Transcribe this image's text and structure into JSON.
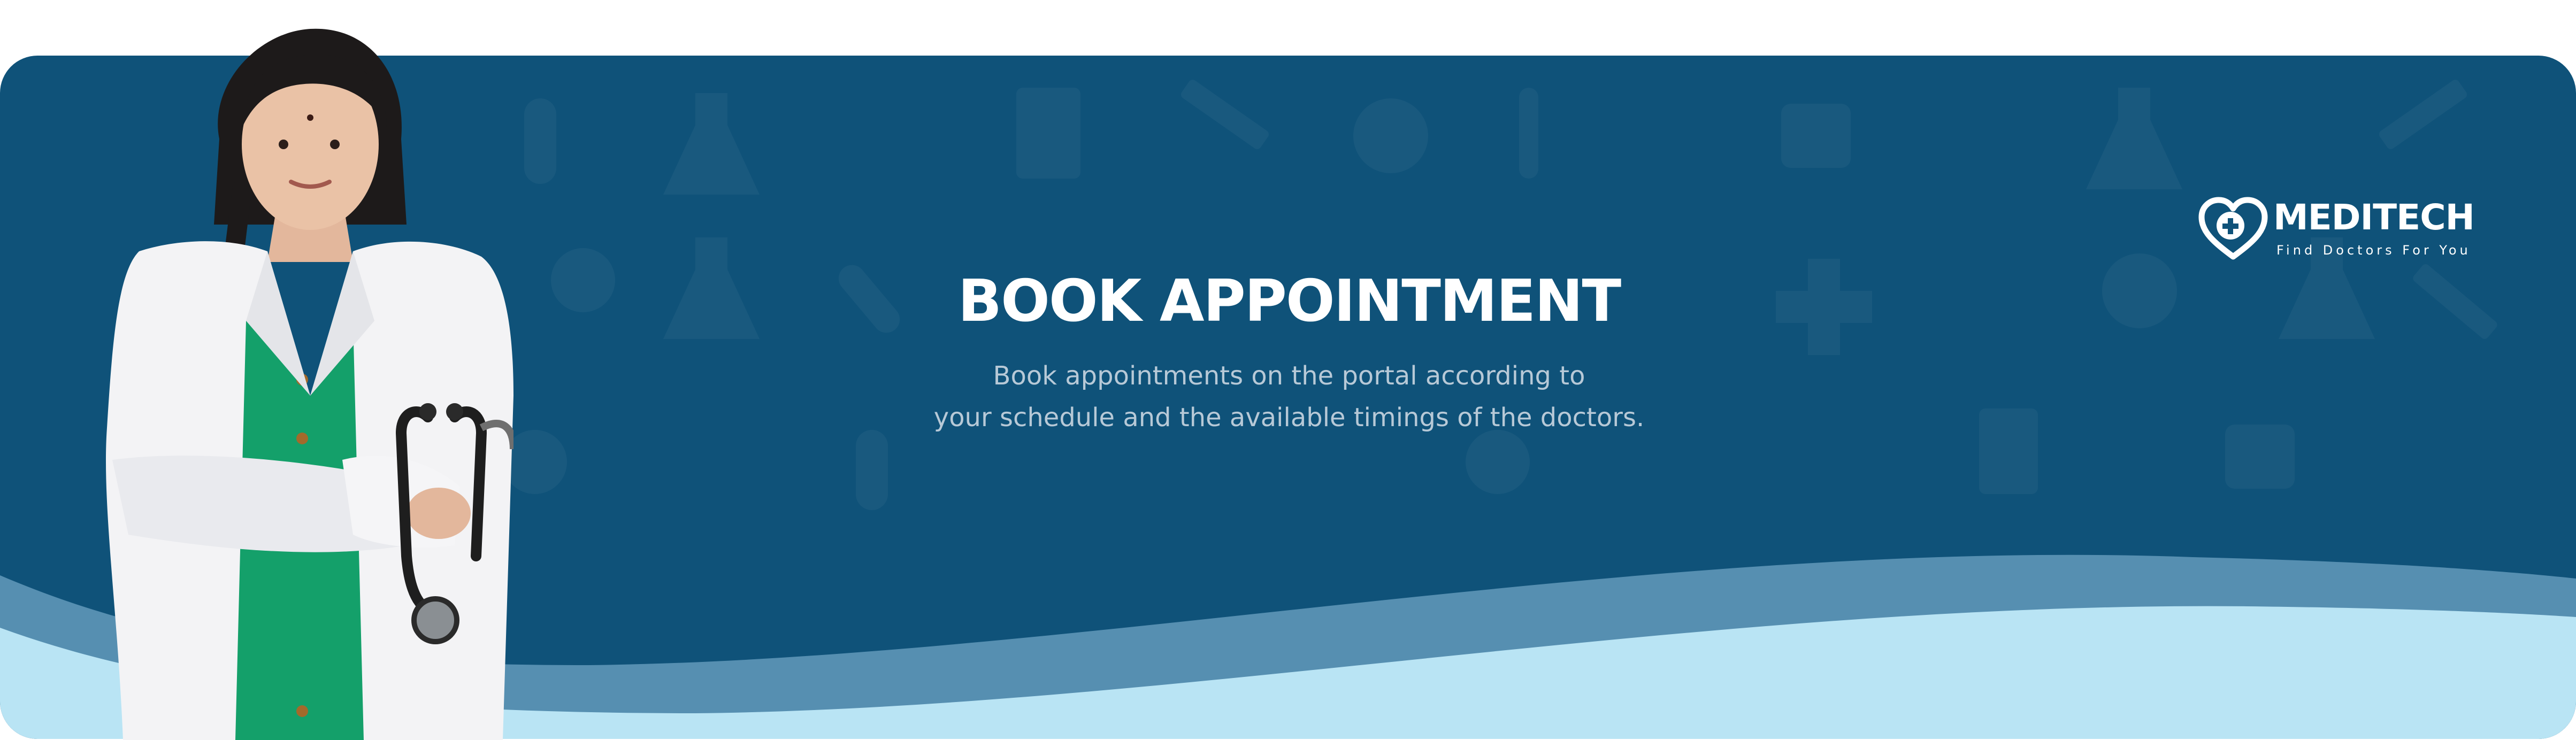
{
  "brand": {
    "name": "MEDITECH",
    "tagline": "Find Doctors For You",
    "logo_icon": "heart-plus-icon"
  },
  "hero": {
    "title": "BOOK APPOINTMENT",
    "subtitle_line1": "Book appointments on the portal according to",
    "subtitle_line2": "your schedule and the available timings of the doctors."
  },
  "image": {
    "subject": "doctor-photo",
    "props": [
      "stethoscope-icon"
    ]
  },
  "colors": {
    "banner_background": "#0f5279",
    "wave_mid": "#568fb1",
    "wave_light": "#b9e4f4",
    "subtitle_text": "#b7c9d7",
    "title_text": "#ffffff",
    "scrub_green": "#14a06a"
  }
}
